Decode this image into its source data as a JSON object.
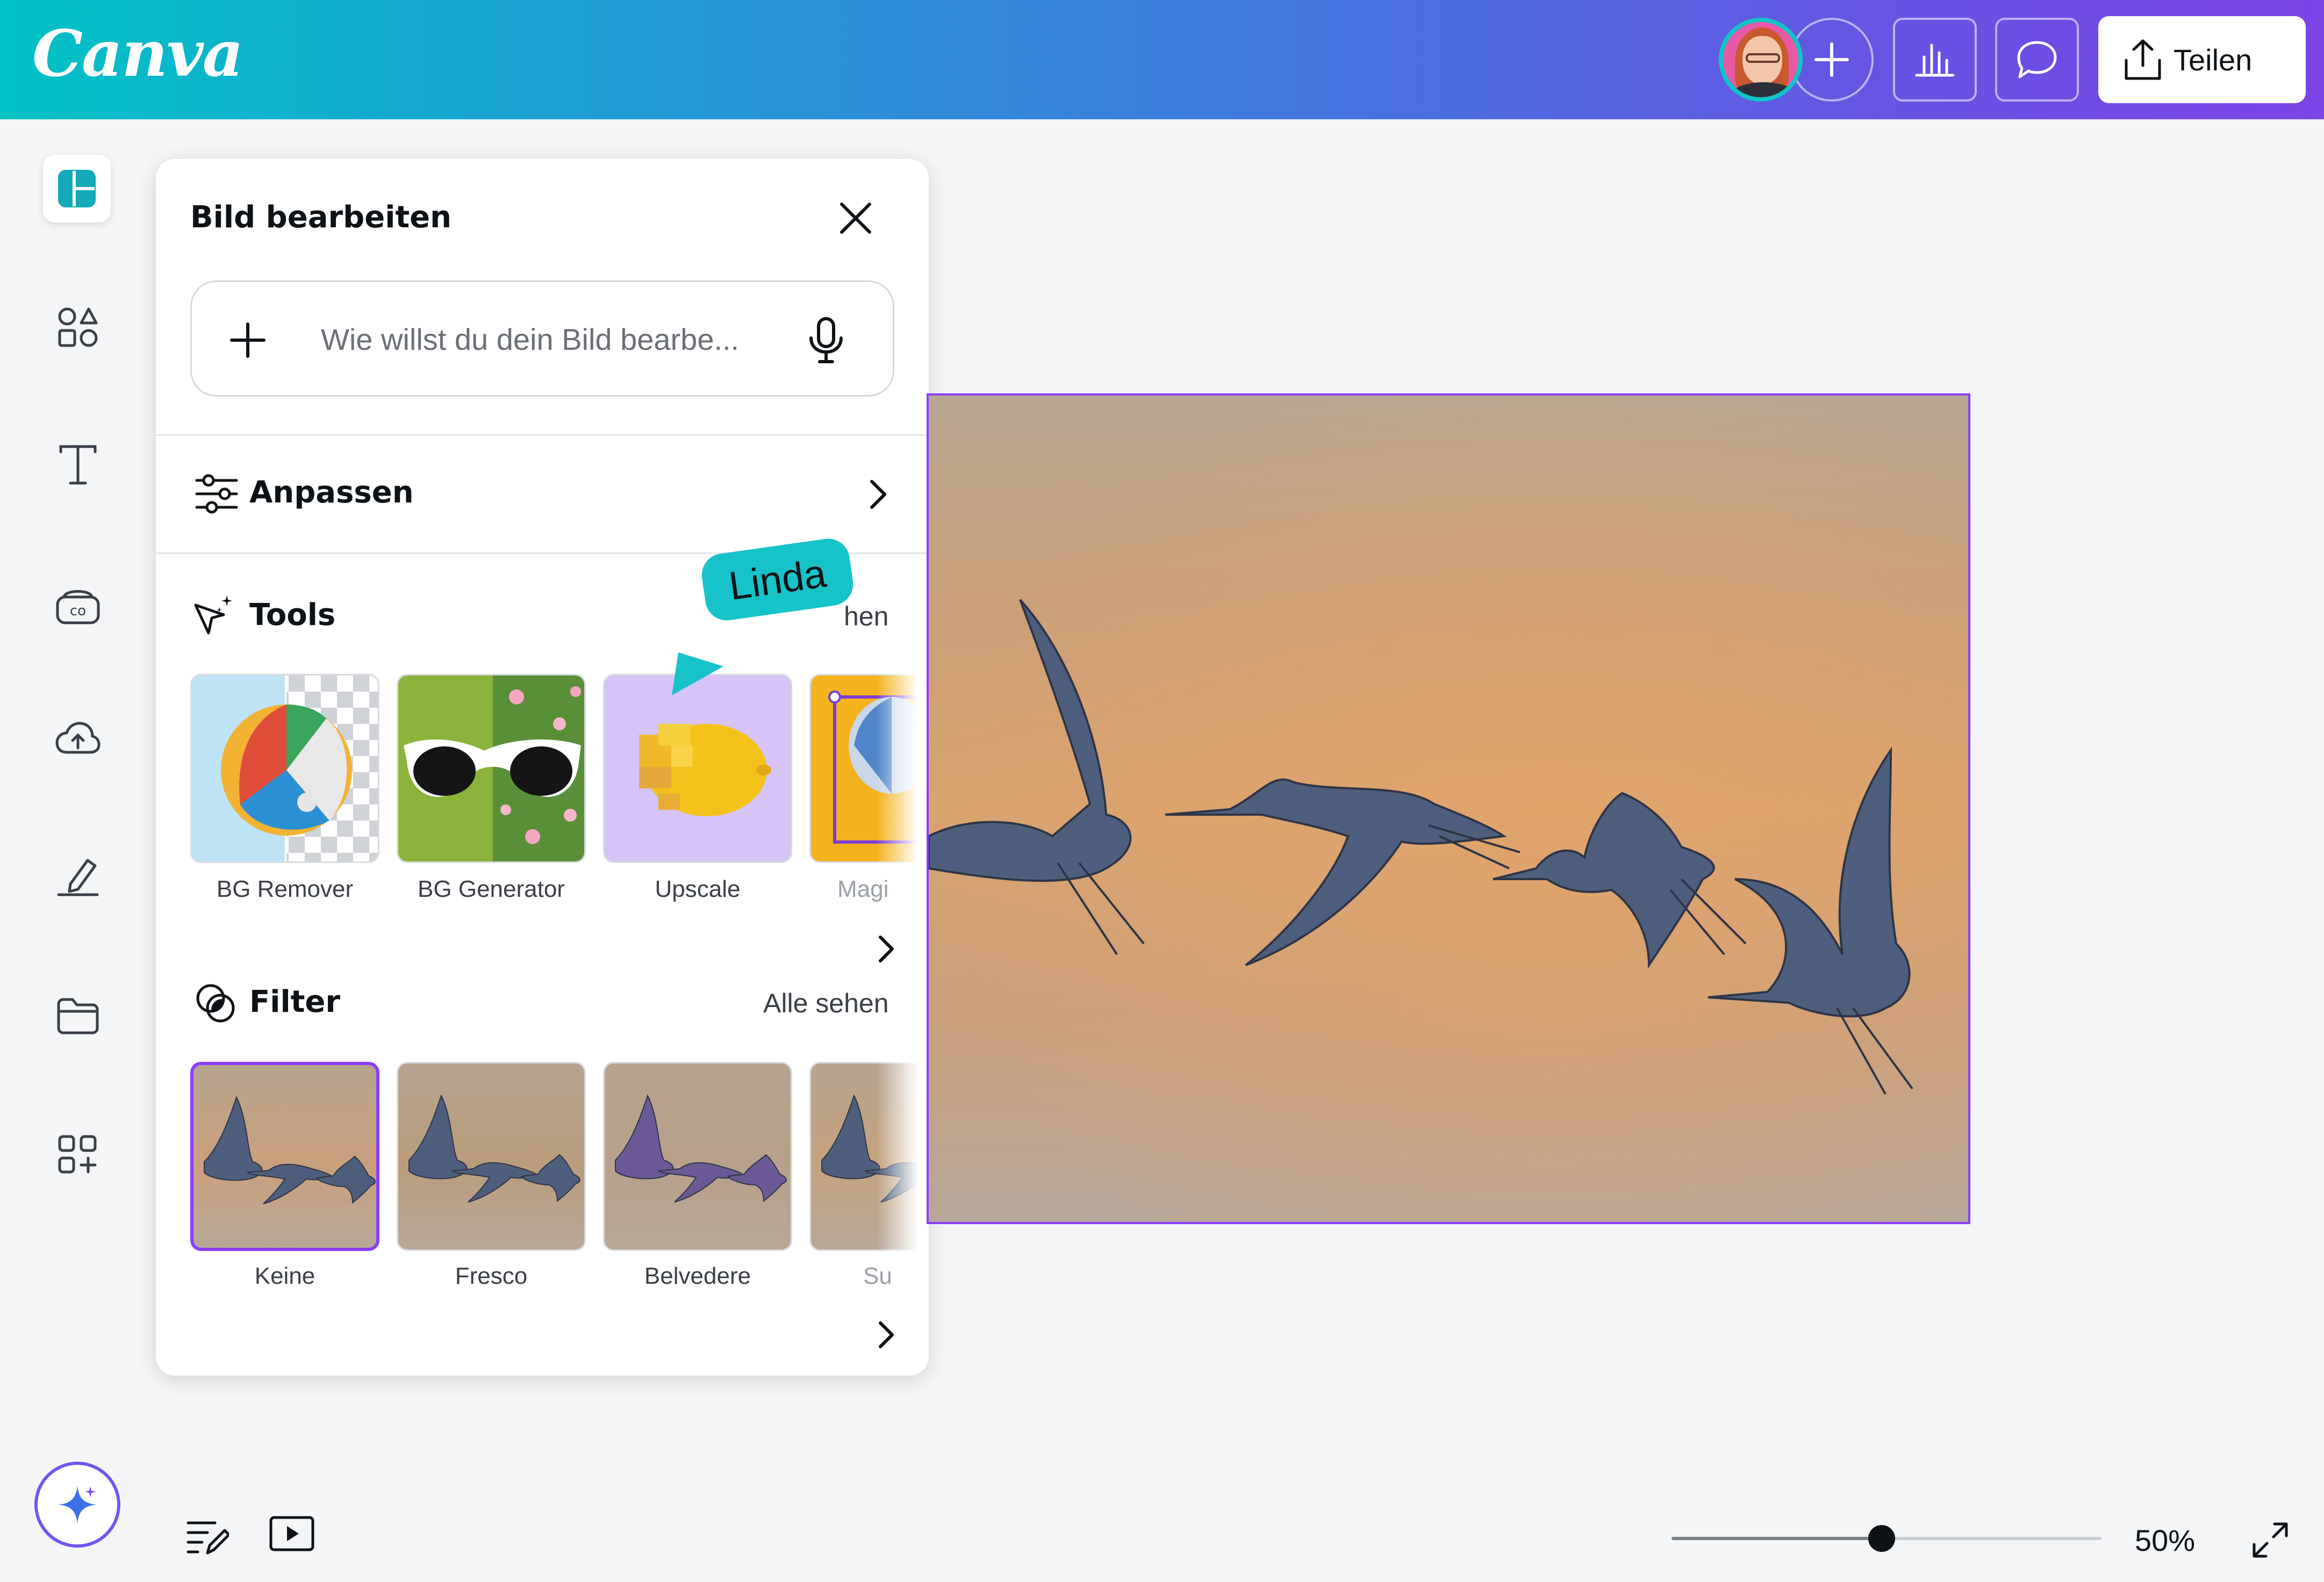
{
  "app": {
    "logo": "Canva"
  },
  "header": {
    "share_label": "Teilen"
  },
  "panel": {
    "title": "Bild bearbeiten",
    "search_placeholder": "Wie willst du dein Bild bearbe...",
    "adjust_label": "Anpassen",
    "tools": {
      "label": "Tools",
      "see_all": "hen",
      "items": [
        {
          "label": "BG Remover"
        },
        {
          "label": "BG Generator"
        },
        {
          "label": "Upscale"
        },
        {
          "label": "Magi"
        }
      ]
    },
    "filters": {
      "label": "Filter",
      "see_all": "Alle sehen",
      "items": [
        {
          "label": "Keine",
          "selected": true
        },
        {
          "label": "Fresco"
        },
        {
          "label": "Belvedere"
        },
        {
          "label": "Su"
        }
      ]
    }
  },
  "collaborator_tag": "Linda",
  "zoom": {
    "value": "50%",
    "level": 0.5
  },
  "colors": {
    "accent": "#8b3dff",
    "teal": "#01c2c5",
    "cursor": "#16c3c9"
  }
}
